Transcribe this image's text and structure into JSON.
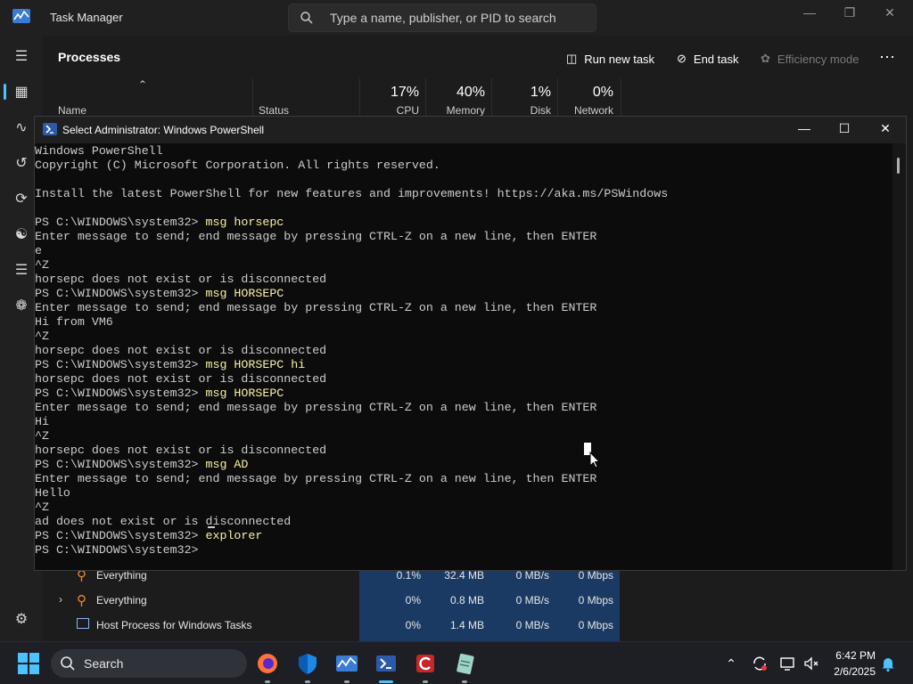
{
  "task_manager": {
    "title": "Task Manager",
    "search_placeholder": "Type a name, publisher, or PID to search",
    "page_title": "Processes",
    "toolbar": {
      "run_new_task": "Run new task",
      "end_task": "End task",
      "efficiency_mode": "Efficiency mode"
    },
    "columns": {
      "name": "Name",
      "status": "Status",
      "cpu_pct": "17%",
      "cpu": "CPU",
      "memory_pct": "40%",
      "memory": "Memory",
      "disk_pct": "1%",
      "disk": "Disk",
      "network_pct": "0%",
      "network": "Network"
    },
    "rows": [
      {
        "name": "Everything",
        "cpu": "0.1%",
        "memory": "32.4 MB",
        "disk": "0 MB/s",
        "network": "0 Mbps"
      },
      {
        "name": "Everything",
        "cpu": "0%",
        "memory": "0.8 MB",
        "disk": "0 MB/s",
        "network": "0 Mbps"
      },
      {
        "name": "Host Process for Windows Tasks",
        "cpu": "0%",
        "memory": "1.4 MB",
        "disk": "0 MB/s",
        "network": "0 Mbps"
      }
    ]
  },
  "powershell": {
    "title": "Select Administrator: Windows PowerShell",
    "lines": [
      {
        "text": "Windows PowerShell"
      },
      {
        "text": "Copyright (C) Microsoft Corporation. All rights reserved."
      },
      {
        "text": ""
      },
      {
        "text": "Install the latest PowerShell for new features and improvements! https://aka.ms/PSWindows"
      },
      {
        "text": ""
      },
      {
        "prompt": "PS C:\\WINDOWS\\system32> ",
        "cmd": "msg horsepc"
      },
      {
        "text": "Enter message to send; end message by pressing CTRL-Z on a new line, then ENTER"
      },
      {
        "text": "e"
      },
      {
        "text": "^Z"
      },
      {
        "text": "horsepc does not exist or is disconnected"
      },
      {
        "prompt": "PS C:\\WINDOWS\\system32> ",
        "cmd": "msg HORSEPC"
      },
      {
        "text": "Enter message to send; end message by pressing CTRL-Z on a new line, then ENTER"
      },
      {
        "text": "Hi from VM6"
      },
      {
        "text": "^Z"
      },
      {
        "text": "horsepc does not exist or is disconnected"
      },
      {
        "prompt": "PS C:\\WINDOWS\\system32> ",
        "cmd": "msg HORSEPC hi"
      },
      {
        "text": "horsepc does not exist or is disconnected"
      },
      {
        "prompt": "PS C:\\WINDOWS\\system32> ",
        "cmd": "msg HORSEPC"
      },
      {
        "text": "Enter message to send; end message by pressing CTRL-Z on a new line, then ENTER"
      },
      {
        "text": "Hi"
      },
      {
        "text": "^Z"
      },
      {
        "text": "horsepc does not exist or is disconnected"
      },
      {
        "prompt": "PS C:\\WINDOWS\\system32> ",
        "cmd": "msg AD"
      },
      {
        "text": "Enter message to send; end message by pressing CTRL-Z on a new line, then ENTER"
      },
      {
        "text": "Hello"
      },
      {
        "text": "^Z"
      },
      {
        "text": "ad does not exist or is disconnected"
      },
      {
        "prompt": "PS C:\\WINDOWS\\system32> ",
        "cmd": "explorer"
      },
      {
        "prompt": "PS C:\\WINDOWS\\system32> ",
        "cmd": ""
      }
    ]
  },
  "taskbar": {
    "search_label": "Search",
    "time": "6:42 PM",
    "date": "2/6/2025",
    "apps": [
      "firefox-icon",
      "defender-icon",
      "task-manager-icon",
      "powershell-icon",
      "ccleaner-icon",
      "notepad-icon"
    ]
  },
  "colors": {
    "accent": "#4cc2ff",
    "console_bg": "#0c0c0c",
    "console_text": "#cccccc",
    "console_cmd": "#f9f1a5",
    "heat": "#1a3a63"
  }
}
